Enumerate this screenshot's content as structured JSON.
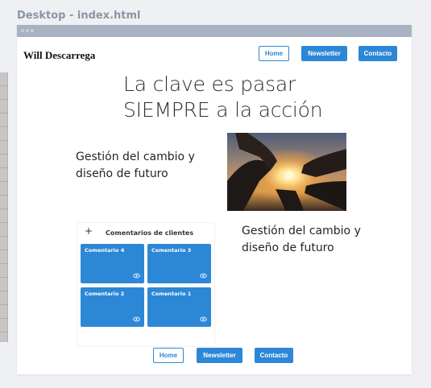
{
  "canvas_label": "Desktop - index.html",
  "header": {
    "brand": "Will Descarrega",
    "nav": {
      "home": "Home",
      "newsletter": "Newsletter",
      "contacto": "Contacto"
    }
  },
  "hero": {
    "line1": "La clave es pasar",
    "line2": "SIEMPRE a la acción"
  },
  "section1": {
    "line1": "Gestión del cambio y",
    "line2": "diseño de futuro"
  },
  "section2": {
    "line1": "Gestión del cambio y",
    "line2": "diseño de futuro"
  },
  "testimonials": {
    "add_symbol": "+",
    "title": "Comentarios de clientes",
    "cards": [
      "Comentario 4",
      "Comentario 3",
      "Comentario 2",
      "Comentario 1"
    ]
  },
  "footer": {
    "nav": {
      "home": "Home",
      "newsletter": "Newsletter",
      "contacto": "Contacto"
    }
  },
  "colors": {
    "accent": "#2c87d7",
    "frame_bar": "#a7b3c2",
    "background": "#eff0f3"
  },
  "icons": {
    "card_view": "eye-icon",
    "add": "plus-icon",
    "window_controls": "window-dots-icon"
  }
}
